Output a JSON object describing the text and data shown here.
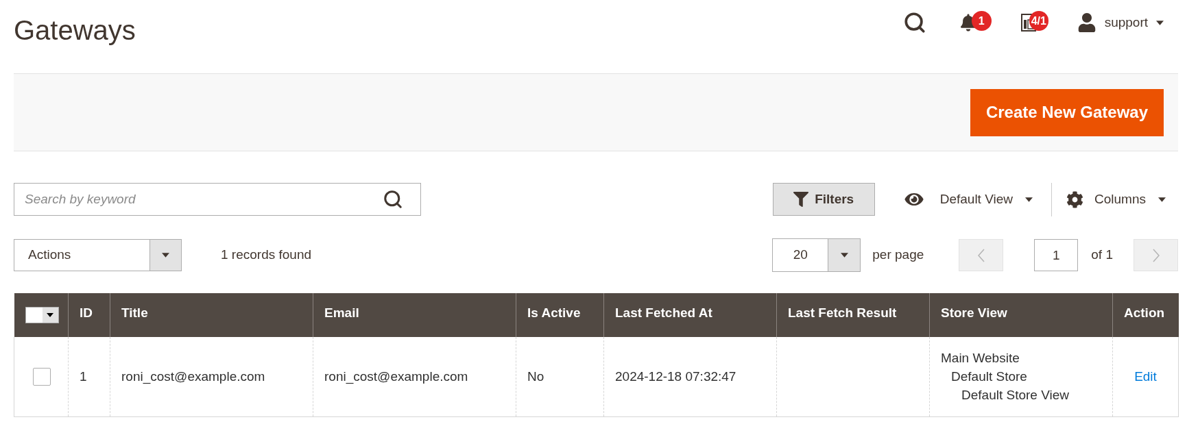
{
  "page_title": "Gateways",
  "header": {
    "notifications": {
      "count": "1"
    },
    "system_messages": {
      "count": "4/1"
    },
    "user": {
      "name": "support"
    }
  },
  "page_actions": {
    "create_button": {
      "label": "Create New Gateway"
    }
  },
  "toolbar": {
    "search": {
      "placeholder": "Search by keyword"
    },
    "filters_button": "Filters",
    "view": "Default View",
    "columns_button": "Columns"
  },
  "mass_actions": {
    "label": "Actions"
  },
  "records_found": "1 records found",
  "pagination": {
    "page_size": "20",
    "per_page_label": "per page",
    "prev": {
      "disabled": true
    },
    "current_page": "1",
    "total_label": "of 1",
    "next": {
      "disabled": true
    }
  },
  "table": {
    "select_all": {
      "checked": false
    },
    "columns": [
      {
        "label": "ID"
      },
      {
        "label": "Title"
      },
      {
        "label": "Email"
      },
      {
        "label": "Is Active"
      },
      {
        "label": "Last Fetched At"
      },
      {
        "label": "Last Fetch Result"
      },
      {
        "label": "Store View"
      },
      {
        "label": "Action"
      }
    ],
    "rows": [
      {
        "selected": false,
        "id": "1",
        "title": "roni_cost@example.com",
        "email": "roni_cost@example.com",
        "is_active": "No",
        "last_fetched_at": "2024-12-18 07:32:47",
        "store_view": [
          {
            "label": "Main Website",
            "children": [
              {
                "label": "Default Store",
                "children": [
                  {
                    "label": "Default Store View"
                  }
                ]
              }
            ]
          }
        ],
        "action": "Edit"
      }
    ]
  }
}
